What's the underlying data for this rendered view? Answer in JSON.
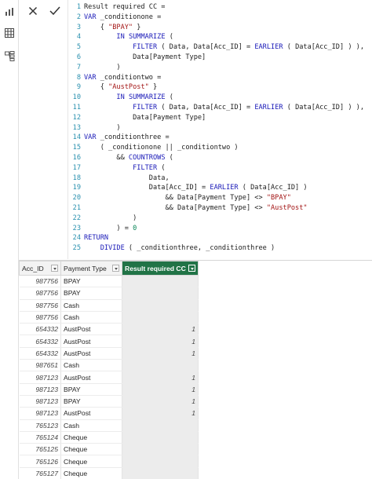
{
  "rail": {
    "icons": [
      "report-icon",
      "data-icon",
      "model-icon"
    ]
  },
  "commit_bar": {
    "cancel_glyph": "✕",
    "confirm_glyph": "✓"
  },
  "code": [
    {
      "n": "1",
      "t": "Result required CC ="
    },
    {
      "n": "2",
      "t": "VAR _conditionone ="
    },
    {
      "n": "3",
      "t": "    { \"BPAY\" }"
    },
    {
      "n": "4",
      "t": "        IN SUMMARIZE ("
    },
    {
      "n": "5",
      "t": "            FILTER ( Data, Data[Acc_ID] = EARLIER ( Data[Acc_ID] ) ),"
    },
    {
      "n": "6",
      "t": "            Data[Payment Type]"
    },
    {
      "n": "7",
      "t": "        )"
    },
    {
      "n": "8",
      "t": "VAR _conditiontwo ="
    },
    {
      "n": "9",
      "t": "    { \"AustPost\" }"
    },
    {
      "n": "10",
      "t": "        IN SUMMARIZE ("
    },
    {
      "n": "11",
      "t": "            FILTER ( Data, Data[Acc_ID] = EARLIER ( Data[Acc_ID] ) ),"
    },
    {
      "n": "12",
      "t": "            Data[Payment Type]"
    },
    {
      "n": "13",
      "t": "        )"
    },
    {
      "n": "14",
      "t": "VAR _conditionthree ="
    },
    {
      "n": "15",
      "t": "    ( _conditionone || _conditiontwo )"
    },
    {
      "n": "16",
      "t": "        && COUNTROWS ("
    },
    {
      "n": "17",
      "t": "            FILTER ("
    },
    {
      "n": "18",
      "t": "                Data,"
    },
    {
      "n": "19",
      "t": "                Data[Acc_ID] = EARLIER ( Data[Acc_ID] )"
    },
    {
      "n": "20",
      "t": "                    && Data[Payment Type] <> \"BPAY\""
    },
    {
      "n": "21",
      "t": "                    && Data[Payment Type] <> \"AustPost\""
    },
    {
      "n": "22",
      "t": "            )"
    },
    {
      "n": "23",
      "t": "        ) = 0"
    },
    {
      "n": "24",
      "t": "RETURN"
    },
    {
      "n": "25",
      "t": "    DIVIDE ( _conditionthree, _conditionthree )"
    }
  ],
  "table": {
    "columns": [
      "Acc_ID",
      "Payment Type",
      "Result required CC"
    ],
    "rows": [
      [
        "987756",
        "BPAY",
        ""
      ],
      [
        "987756",
        "BPAY",
        ""
      ],
      [
        "987756",
        "Cash",
        ""
      ],
      [
        "987756",
        "Cash",
        ""
      ],
      [
        "654332",
        "AustPost",
        "1"
      ],
      [
        "654332",
        "AustPost",
        "1"
      ],
      [
        "654332",
        "AustPost",
        "1"
      ],
      [
        "987651",
        "Cash",
        ""
      ],
      [
        "987123",
        "AustPost",
        "1"
      ],
      [
        "987123",
        "BPAY",
        "1"
      ],
      [
        "987123",
        "BPAY",
        "1"
      ],
      [
        "987123",
        "AustPost",
        "1"
      ],
      [
        "765123",
        "Cash",
        ""
      ],
      [
        "765124",
        "Cheque",
        ""
      ],
      [
        "765125",
        "Cheque",
        ""
      ],
      [
        "765126",
        "Cheque",
        ""
      ],
      [
        "765127",
        "Cheque",
        ""
      ]
    ]
  }
}
